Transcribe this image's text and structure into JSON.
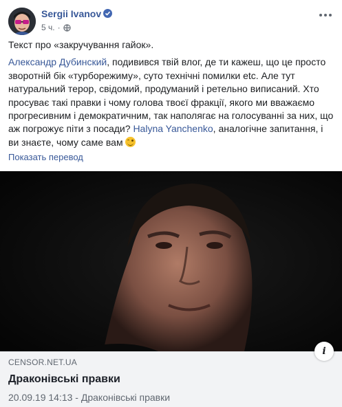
{
  "post": {
    "author": "Sergii Ivanov",
    "timestamp": "5 ч.",
    "privacy_icon": "globe-icon",
    "verified_icon": "verified-badge-icon",
    "more_icon": "more-options-icon"
  },
  "body": {
    "line1": "Текст про «закручування гайок».",
    "mention1": "Александр Дубинский",
    "text2": ", подивився твій влог, де ти кажеш, що це просто зворотній бік «турборежиму», суто технічні помилки etc. Але тут натуральний терор, свідомий, продуманий і ретельно виписаний. Хто просуває такі правки і чому голова твоєї фракції, якого ми вважаємо прогресивним і демократичним, так наполягає на голосуванні за них, що аж погрожує піти з посади? ",
    "mention2": "Halyna Yanchenko",
    "text3": ", аналогічне запитання, і ви знаєте, чому саме вам ",
    "emoji": "winking-face-emoji"
  },
  "translate_label": "Показать перевод",
  "link": {
    "domain": "CENSOR.NET.UA",
    "title": "Драконівські правки",
    "description": "20.09.19 14:13 - Драконівські правки",
    "info_icon": "i"
  }
}
